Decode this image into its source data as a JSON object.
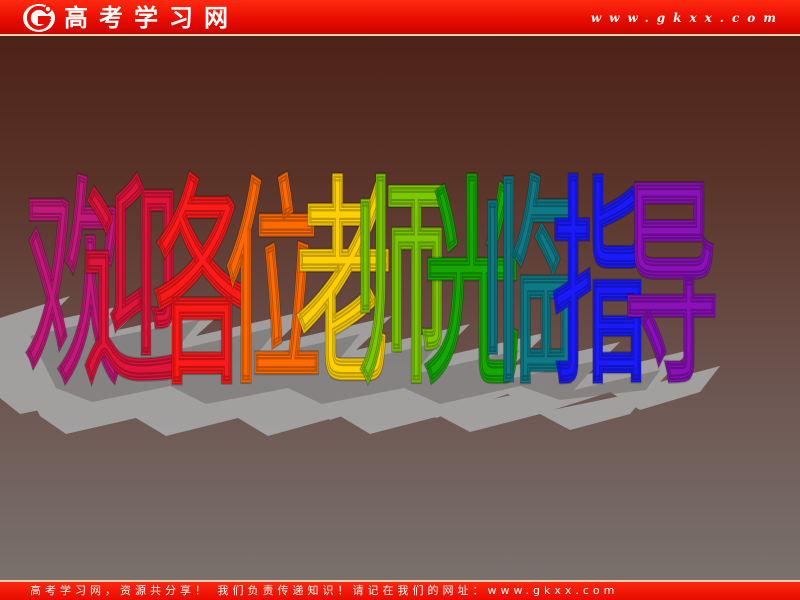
{
  "header": {
    "logo_text": "高考学习网",
    "url": "www.gkxx.com",
    "logo_icon": "gkxx-g-logo-icon",
    "bar_color": "#e80c00"
  },
  "welcome": {
    "characters": [
      {
        "char": "欢",
        "color": "#c2187a"
      },
      {
        "char": "迎",
        "color": "#e0143a"
      },
      {
        "char": "各",
        "color": "#ff1a1a"
      },
      {
        "char": "位",
        "color": "#ff6a00"
      },
      {
        "char": "老",
        "color": "#ffd000"
      },
      {
        "char": "师",
        "color": "#7cc800"
      },
      {
        "char": "光",
        "color": "#16a800"
      },
      {
        "char": "临",
        "color": "#0e7a86"
      },
      {
        "char": "指",
        "color": "#1a1aff"
      },
      {
        "char": "导",
        "color": "#8a10b8"
      }
    ]
  },
  "footer": {
    "text": "高考学习网，资源共分享！ 我们负责传递知识！请记在我们的网址：www.gkxx.com"
  },
  "colors": {
    "background_top": "#4a1e14",
    "background_bottom": "#7b7470",
    "shadow": "#a8a8a8"
  }
}
